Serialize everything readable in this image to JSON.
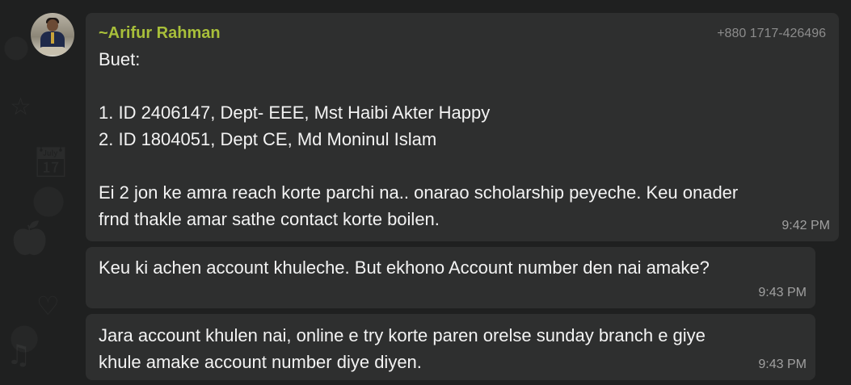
{
  "chat": {
    "messages": [
      {
        "sender_name": "~Arifur Rahman",
        "sender_phone": "+880 1717-426496",
        "text": "Buet:\n\n1. ID 2406147, Dept- EEE, Mst Haibi Akter Happy\n2. ID 1804051, Dept CE, Md Moninul Islam\n\nEi 2 jon ke amra reach korte parchi na.. onarao scholarship peyeche. Keu onader\nfrnd thakle amar sathe contact korte boilen.",
        "time": "9:42 PM"
      },
      {
        "text": "Keu ki achen account khuleche. But ekhono Account number den nai amake?",
        "time": "9:43 PM"
      },
      {
        "text": "Jara account khulen nai, online e try korte paren orelse sunday branch e giye\nkhule amake account number diye diyen.",
        "time": "9:43 PM"
      }
    ]
  },
  "colors": {
    "background": "#1f2020",
    "bubble": "#2e2f2f",
    "sender_name": "#a8bf3a",
    "phone": "#8c8c8c",
    "timestamp": "#a0a0a0",
    "text": "#f3f3f3"
  },
  "icons": {
    "avatar": "profile-photo"
  }
}
